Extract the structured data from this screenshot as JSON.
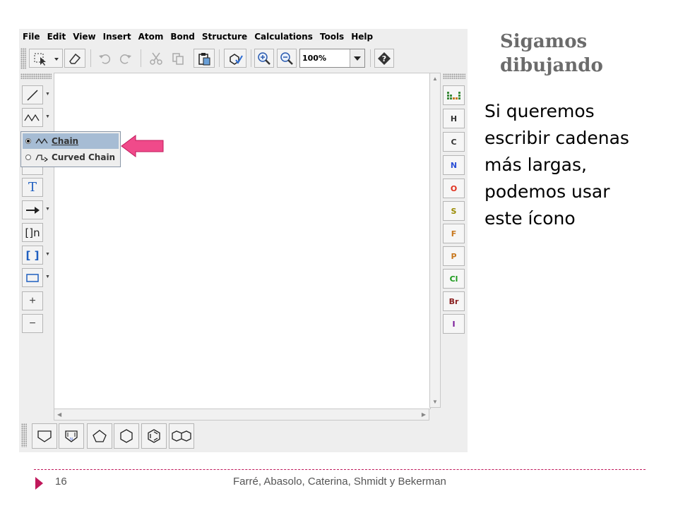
{
  "app": {
    "menus": [
      "File",
      "Edit",
      "View",
      "Insert",
      "Atom",
      "Bond",
      "Structure",
      "Calculations",
      "Tools",
      "Help"
    ],
    "zoom_value": "100%",
    "chain_menu": {
      "items": [
        {
          "label": "Chain",
          "selected": true
        },
        {
          "label": "Curved Chain",
          "selected": false
        }
      ]
    },
    "left_tools": {
      "text_tool_label": "T",
      "bracket_n_label": "[]n",
      "bracket_label": "[ ]",
      "plus_label": "+",
      "minus_label": "−"
    },
    "atoms": [
      {
        "symbol": "H",
        "color": "#333333"
      },
      {
        "symbol": "C",
        "color": "#333333"
      },
      {
        "symbol": "N",
        "color": "#2b4fd6"
      },
      {
        "symbol": "O",
        "color": "#e0301e"
      },
      {
        "symbol": "S",
        "color": "#9a8a00"
      },
      {
        "symbol": "F",
        "color": "#c8781e"
      },
      {
        "symbol": "P",
        "color": "#c8781e"
      },
      {
        "symbol": "Cl",
        "color": "#1a9a1a"
      },
      {
        "symbol": "Br",
        "color": "#8a2020"
      },
      {
        "symbol": "I",
        "color": "#7a1a9a"
      }
    ],
    "bottom_templates": [
      "cyclopropane-like",
      "pyrrole-like",
      "pentagon",
      "hexagon",
      "benzene",
      "naphthalene"
    ]
  },
  "slide": {
    "title_line1": "Sigamos",
    "title_line2": "dibujando",
    "bullet_lines": [
      "Si queremos",
      "escribir cadenas",
      "más largas,",
      "podemos usar",
      "este ícono"
    ],
    "page_number": "16",
    "footer": "Farré, Abasolo, Caterina, Shmidt y Bekerman"
  },
  "colors": {
    "accent": "#c0185b",
    "arrow": "#f04a8a",
    "selection": "#a6bcd4"
  }
}
